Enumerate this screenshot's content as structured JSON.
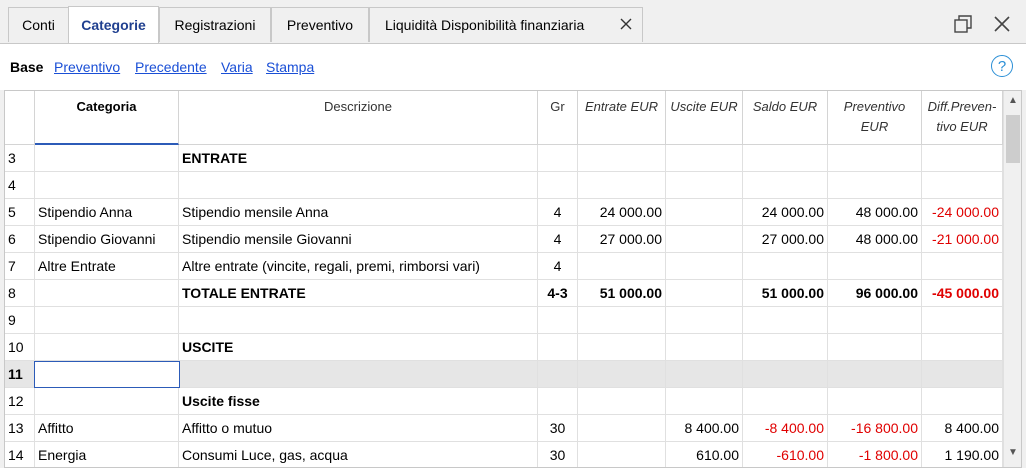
{
  "tabs": [
    {
      "label": "Conti",
      "active": false
    },
    {
      "label": "Categorie",
      "active": true
    },
    {
      "label": "Registrazioni",
      "active": false
    },
    {
      "label": "Preventivo",
      "active": false
    },
    {
      "label": "Liquidità Disponibilità finanziaria",
      "active": false,
      "closable": true
    }
  ],
  "subnav": {
    "base": "Base",
    "links": [
      "Preventivo",
      "Precedente",
      "Varia",
      "Stampa"
    ],
    "help_glyph": "?"
  },
  "columns": [
    {
      "label": "Categoria"
    },
    {
      "label": "Descrizione"
    },
    {
      "label": "Gr"
    },
    {
      "label": "Entrate EUR"
    },
    {
      "label": "Uscite EUR"
    },
    {
      "label": "Saldo EUR"
    },
    {
      "label_1": "Preventivo",
      "label_2": "EUR"
    },
    {
      "label_1": "Diff.Preven-",
      "label_2": "tivo EUR"
    }
  ],
  "rows": [
    {
      "n": "3",
      "cat": "",
      "desc": "ENTRATE",
      "gr": "",
      "ent": "",
      "usc": "",
      "sal": "",
      "prev": "",
      "diff": "",
      "bold": true
    },
    {
      "n": "4",
      "cat": "",
      "desc": "",
      "gr": "",
      "ent": "",
      "usc": "",
      "sal": "",
      "prev": "",
      "diff": ""
    },
    {
      "n": "5",
      "cat": "Stipendio Anna",
      "desc": "Stipendio mensile Anna",
      "gr": "4",
      "ent": "24 000.00",
      "usc": "",
      "sal": "24 000.00",
      "prev": "48 000.00",
      "diff": "-24 000.00"
    },
    {
      "n": "6",
      "cat": "Stipendio Giovanni",
      "desc": "Stipendio mensile Giovanni",
      "gr": "4",
      "ent": "27 000.00",
      "usc": "",
      "sal": "27 000.00",
      "prev": "48 000.00",
      "diff": "-21 000.00"
    },
    {
      "n": "7",
      "cat": "Altre Entrate",
      "desc": "Altre entrate (vincite, regali, premi, rimborsi vari)",
      "gr": "4",
      "ent": "",
      "usc": "",
      "sal": "",
      "prev": "",
      "diff": ""
    },
    {
      "n": "8",
      "cat": "",
      "desc": "TOTALE ENTRATE",
      "gr": "4-3",
      "ent": "51 000.00",
      "usc": "",
      "sal": "51 000.00",
      "prev": "96 000.00",
      "diff": "-45 000.00",
      "bold": true
    },
    {
      "n": "9",
      "cat": "",
      "desc": "",
      "gr": "",
      "ent": "",
      "usc": "",
      "sal": "",
      "prev": "",
      "diff": ""
    },
    {
      "n": "10",
      "cat": "",
      "desc": "USCITE",
      "gr": "",
      "ent": "",
      "usc": "",
      "sal": "",
      "prev": "",
      "diff": "",
      "bold": true
    },
    {
      "n": "11",
      "cat": "",
      "desc": "",
      "gr": "",
      "ent": "",
      "usc": "",
      "sal": "",
      "prev": "",
      "diff": "",
      "current": true
    },
    {
      "n": "12",
      "cat": "",
      "desc": "Uscite fisse",
      "gr": "",
      "ent": "",
      "usc": "",
      "sal": "",
      "prev": "",
      "diff": "",
      "bold": true
    },
    {
      "n": "13",
      "cat": "Affitto",
      "desc": "Affitto o mutuo",
      "gr": "30",
      "ent": "",
      "usc": "8 400.00",
      "sal": "-8 400.00",
      "prev": "-16 800.00",
      "diff": "8 400.00"
    },
    {
      "n": "14",
      "cat": "Energia",
      "desc": "Consumi Luce, gas, acqua",
      "gr": "30",
      "ent": "",
      "usc": "610.00",
      "sal": "-610.00",
      "prev": "-1 800.00",
      "diff": "1 190.00"
    }
  ],
  "colors": {
    "accent": "#1f3f8f",
    "link": "#1a4fd6",
    "negative": "#e00000",
    "help": "#2b8fd6"
  }
}
